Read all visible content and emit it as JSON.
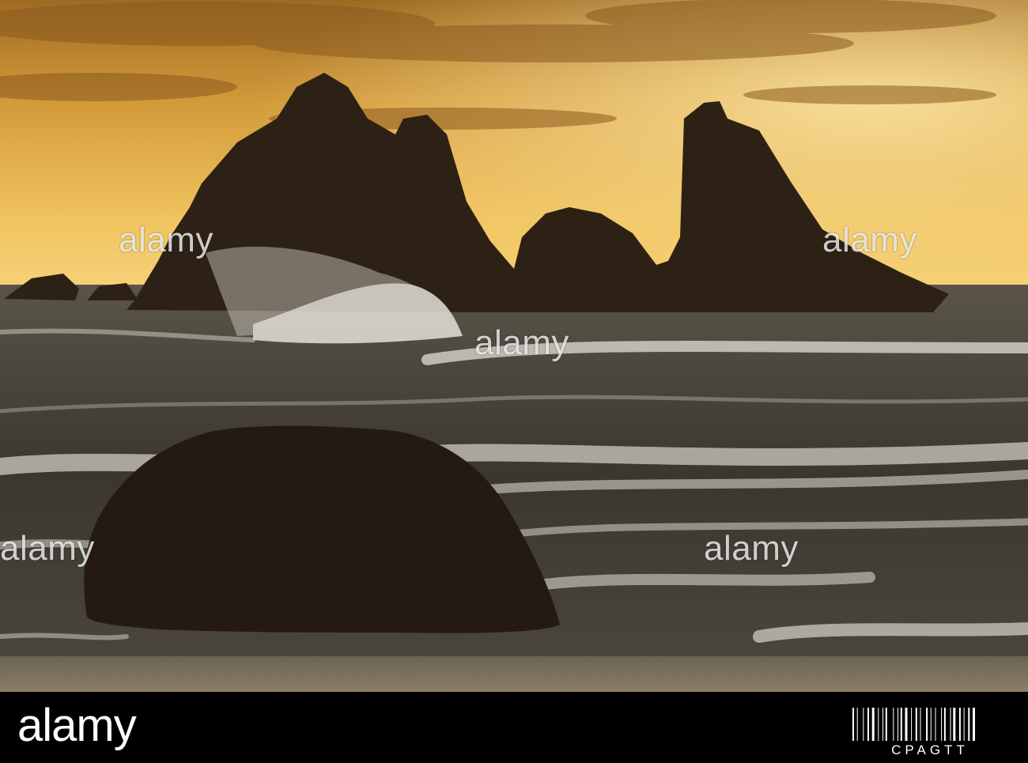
{
  "watermark": {
    "text": "alamy"
  },
  "footer": {
    "logo": "alamy",
    "image_id": "CPAGTT"
  },
  "colors": {
    "sky_top": "#c98a2a",
    "sky_glow": "#f3c96a",
    "rock": "#2a1e12",
    "sea": "#3d3a33",
    "foam": "#d9d6cf"
  }
}
